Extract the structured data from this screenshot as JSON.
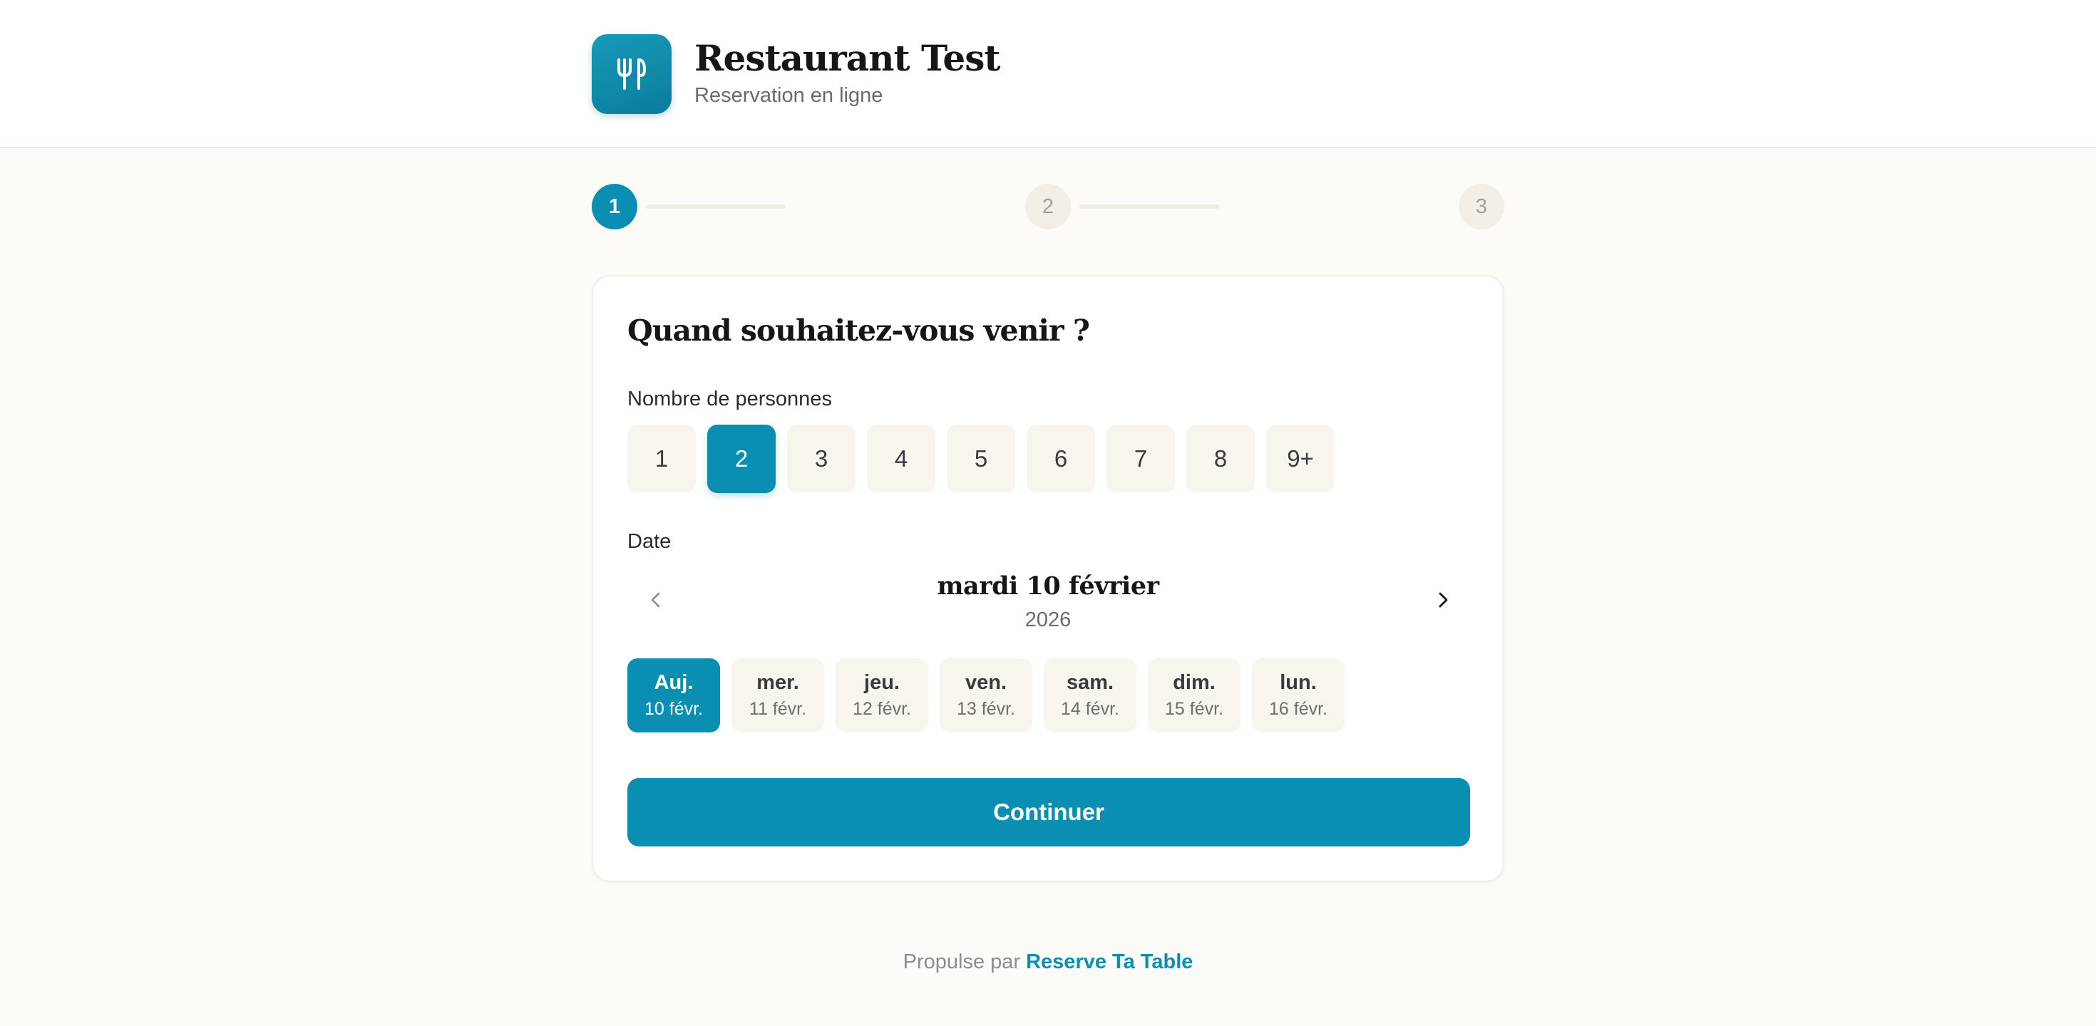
{
  "header": {
    "brand_name": "Restaurant Test",
    "brand_subtitle": "Reservation en ligne",
    "logo_icon": "fork-knife-icon"
  },
  "stepper": {
    "steps": [
      "1",
      "2",
      "3"
    ],
    "current": 1
  },
  "form": {
    "title": "Quand souhaitez-vous venir ?",
    "party_label": "Nombre de personnes",
    "party_options": [
      "1",
      "2",
      "3",
      "4",
      "5",
      "6",
      "7",
      "8",
      "9+"
    ],
    "party_selected": "2",
    "date_label": "Date",
    "selected_date": "mardi 10 février",
    "selected_year": "2026",
    "days": [
      {
        "name": "Auj.",
        "date": "10 févr."
      },
      {
        "name": "mer.",
        "date": "11 févr."
      },
      {
        "name": "jeu.",
        "date": "12 févr."
      },
      {
        "name": "ven.",
        "date": "13 févr."
      },
      {
        "name": "sam.",
        "date": "14 févr."
      },
      {
        "name": "dim.",
        "date": "15 févr."
      },
      {
        "name": "lun.",
        "date": "16 févr."
      }
    ],
    "continue_label": "Continuer"
  },
  "footer": {
    "prefix": "Propulse par",
    "link": "Reserve Ta Table"
  },
  "colors": {
    "accent": "#0a8fb3",
    "background": "#fcfbf8"
  }
}
